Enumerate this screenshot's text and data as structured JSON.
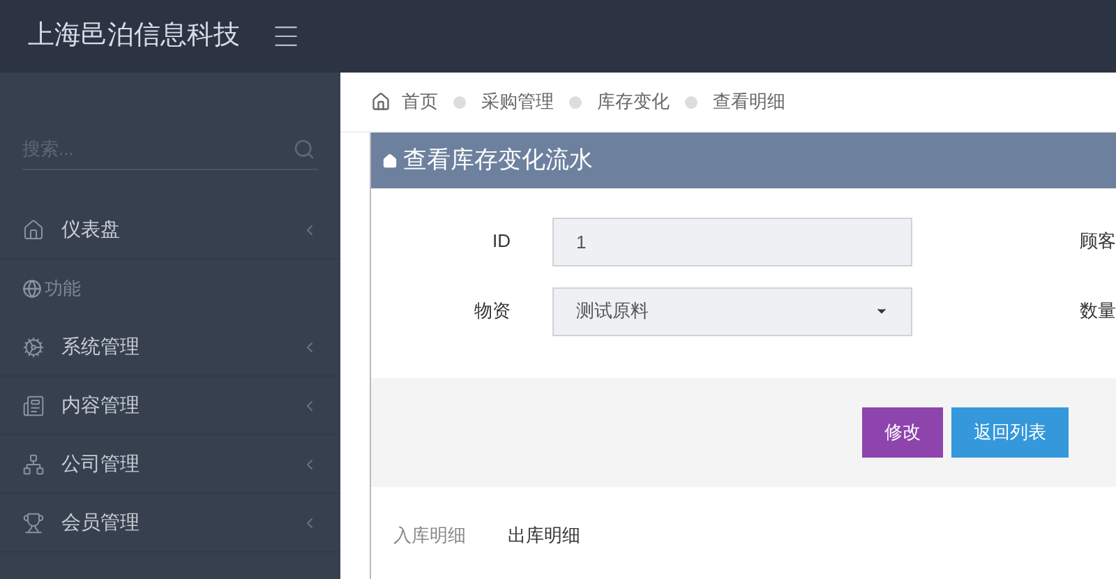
{
  "header": {
    "brand": "上海邑泊信息科技"
  },
  "sidebar": {
    "search": {
      "placeholder": "搜索..."
    },
    "items": [
      {
        "kind": "item",
        "label": "仪表盘"
      },
      {
        "kind": "header",
        "label": "功能"
      },
      {
        "kind": "item",
        "label": "系统管理"
      },
      {
        "kind": "item",
        "label": "内容管理"
      },
      {
        "kind": "item",
        "label": "公司管理"
      },
      {
        "kind": "item",
        "label": "会员管理"
      }
    ]
  },
  "breadcrumb": [
    "首页",
    "采购管理",
    "库存变化",
    "查看明细"
  ],
  "panel": {
    "title": "查看库存变化流水",
    "rows": [
      {
        "label": "ID",
        "kind": "input",
        "value": "1",
        "side_label": "顾客"
      },
      {
        "label": "物资",
        "kind": "select",
        "value": "测试原料",
        "side_label": "数量"
      }
    ],
    "buttons": [
      {
        "kind": "edit",
        "label": "修改"
      },
      {
        "kind": "back",
        "label": "返回列表"
      }
    ]
  },
  "tabs": [
    {
      "label": "入库明细",
      "selected": false
    },
    {
      "label": "出库明细",
      "selected": true
    }
  ]
}
